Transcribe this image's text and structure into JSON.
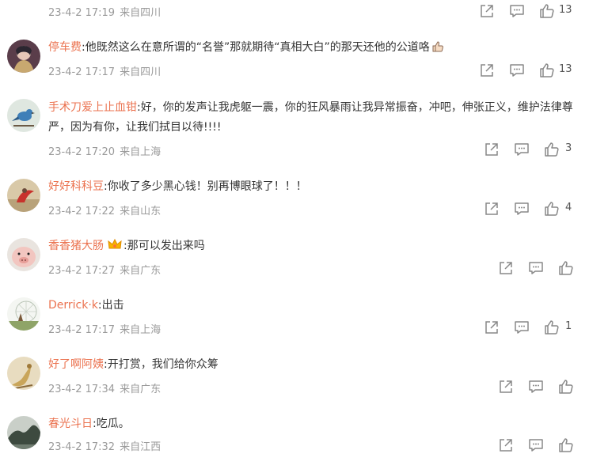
{
  "comments": [
    {
      "user": "",
      "text": "",
      "date": "23-4-2 17:19",
      "loc": "来自四川",
      "likes": "13"
    },
    {
      "user": "停车费",
      "text": ":他既然这么在意所谓的“名誉”那就期待“真相大白”的那天还他的公道咯",
      "emoji": "thumbs-up-emoji",
      "date": "23-4-2 17:17",
      "loc": "来自四川",
      "likes": "13"
    },
    {
      "user": "手术刀爱上止血钳",
      "text": ":好，你的发声让我虎躯一震，你的狂风暴雨让我异常振奋，冲吧，伸张正义，维护法律尊严，因为有你，让我们拭目以待!!!!",
      "date": "23-4-2 17:20",
      "loc": "来自上海",
      "likes": "3"
    },
    {
      "user": "好好科科豆",
      "text": ":你收了多少黑心钱！别再博眼球了！！！",
      "date": "23-4-2 17:22",
      "loc": "来自山东",
      "likes": "4"
    },
    {
      "user": "香香猪大肠",
      "badge": "crown-badge-icon",
      "text": ":那可以发出来吗",
      "date": "23-4-2 17:27",
      "loc": "来自广东",
      "likes": ""
    },
    {
      "user": "Derrick·k",
      "text": ":出击",
      "date": "23-4-2 17:17",
      "loc": "来自上海",
      "likes": "1"
    },
    {
      "user": "好了啊阿姨",
      "text": ":开打赏，我们给你众筹",
      "date": "23-4-2 17:34",
      "loc": "来自广东",
      "likes": ""
    },
    {
      "user": "春光斗日",
      "text": ":吃瓜。",
      "date": "23-4-2 17:32",
      "loc": "来自江西",
      "likes": ""
    }
  ],
  "colors": {
    "username": "#eb7350",
    "meta": "#9a9a9a",
    "icon": "#888888"
  }
}
